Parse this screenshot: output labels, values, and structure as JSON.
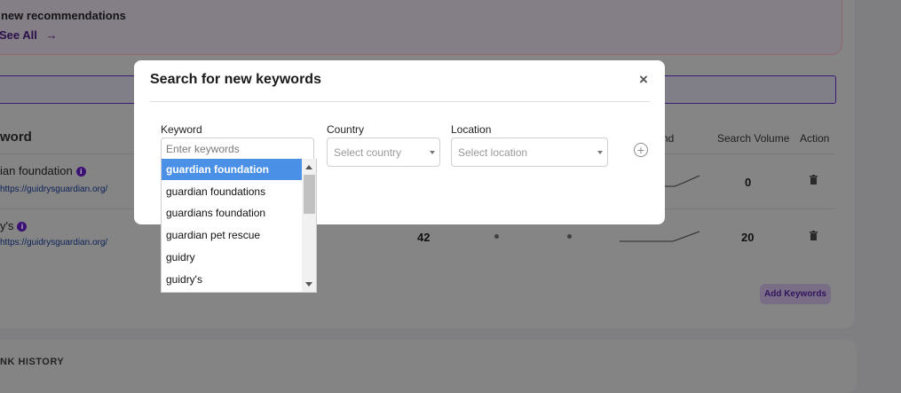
{
  "recommendations": {
    "title": "new recommendations",
    "see_all": "See All",
    "arrow": "→"
  },
  "table": {
    "keyword_header": "word",
    "trend_header": "nd",
    "search_volume_header": "Search Volume",
    "action_header": "Action",
    "rows": [
      {
        "keyword": "ian foundation",
        "url": "https://guidrysguardian.org/",
        "rank": "",
        "search_volume": "0"
      },
      {
        "keyword": "y's",
        "url": "https://guidrysguardian.org/",
        "rank": "42",
        "search_volume": "20"
      }
    ],
    "add_keywords": "Add Keywords"
  },
  "history": {
    "title": "NK HISTORY"
  },
  "modal": {
    "title": "Search for new keywords",
    "close": "×",
    "keyword_label": "Keyword",
    "keyword_placeholder": "Enter keywords",
    "country_label": "Country",
    "country_placeholder": "Select country",
    "location_label": "Location",
    "location_placeholder": "Select location",
    "add_icon": "+",
    "suggestions": [
      "guardian foundation",
      "guardian foundations",
      "guardians foundation",
      "guardian pet rescue",
      "guidry",
      "guidry's"
    ],
    "selected_index": 0
  },
  "colors": {
    "accent_purple": "#3b1074",
    "selected_blue": "#4a90e6"
  }
}
